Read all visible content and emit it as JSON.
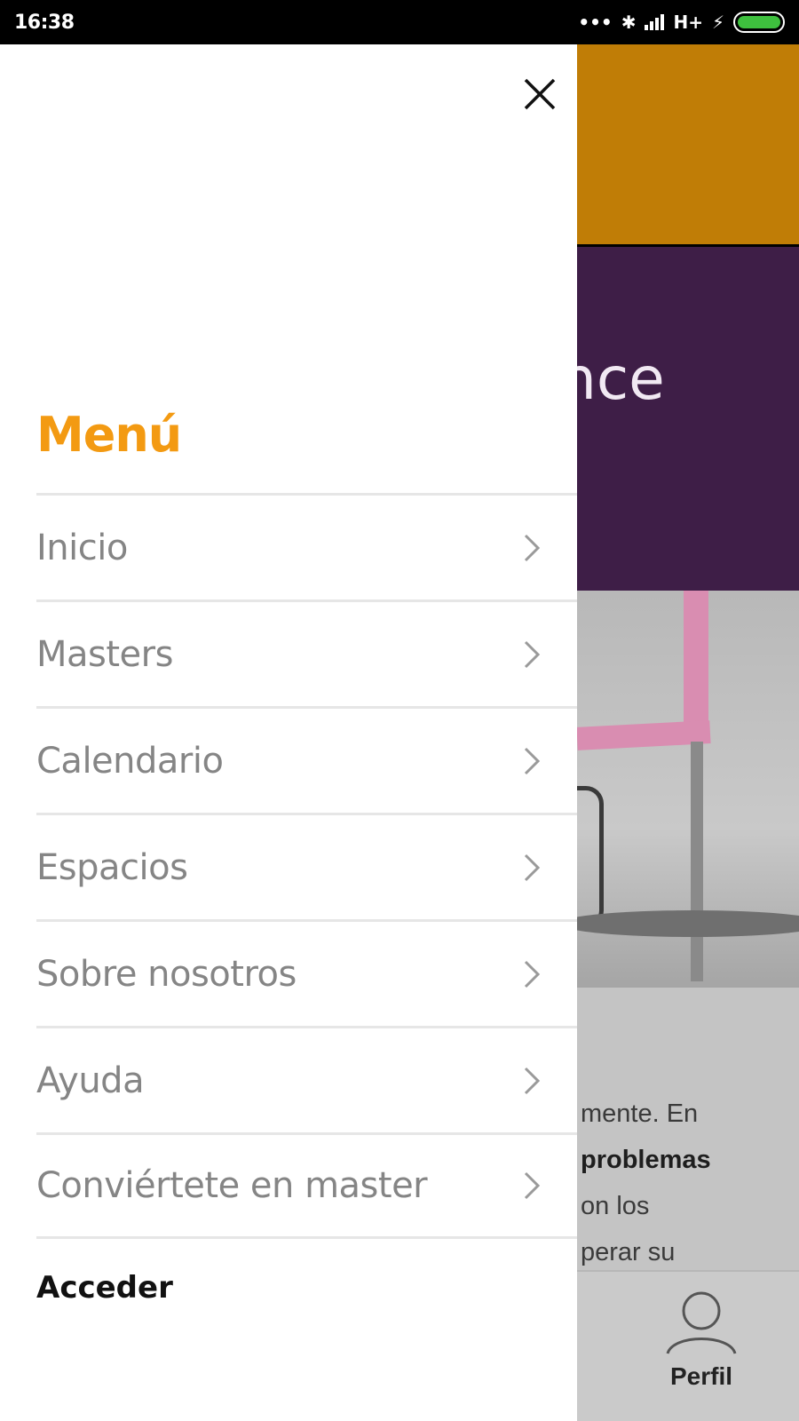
{
  "status_bar": {
    "time": "16:38",
    "network_label": "H+",
    "battery_color": "#3ec03e"
  },
  "background": {
    "hero_title_fragment": "nce",
    "body_lines": [
      "mente. En",
      "problemas",
      "on los",
      "perar su"
    ],
    "bottom_nav_label": "Perfil"
  },
  "drawer": {
    "title": "Menú",
    "title_color": "#f39a12",
    "items": [
      {
        "label": "Inicio"
      },
      {
        "label": "Masters"
      },
      {
        "label": "Calendario"
      },
      {
        "label": "Espacios"
      },
      {
        "label": "Sobre nosotros"
      },
      {
        "label": "Ayuda"
      },
      {
        "label": "Conviértete en master"
      }
    ],
    "login_label": "Acceder"
  },
  "colors": {
    "orange_header": "#c07d06",
    "purple_hero": "#3e1e47"
  }
}
